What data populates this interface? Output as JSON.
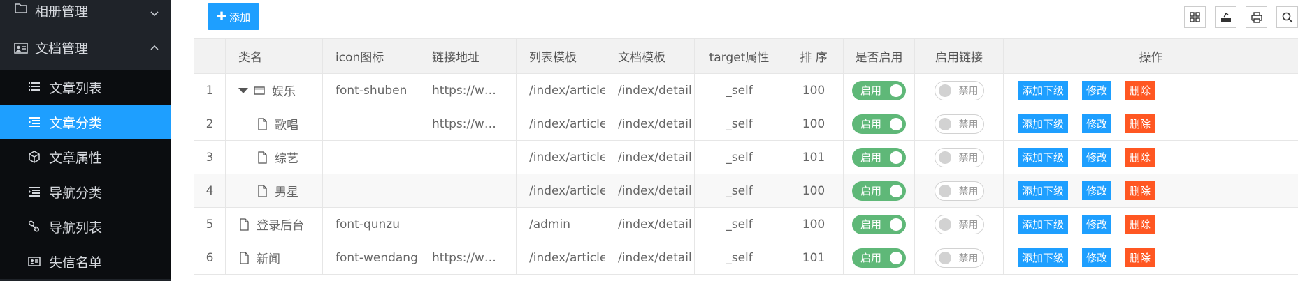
{
  "sidebar": {
    "groups": [
      {
        "label": "相册管理",
        "icon": "folder-icon",
        "expanded": false
      },
      {
        "label": "文档管理",
        "icon": "id-card-icon",
        "expanded": true
      }
    ],
    "items": [
      {
        "label": "文章列表",
        "icon": "list-icon",
        "active": false
      },
      {
        "label": "文章分类",
        "icon": "indent-list-icon",
        "active": true
      },
      {
        "label": "文章属性",
        "icon": "cube-icon",
        "active": false
      },
      {
        "label": "导航分类",
        "icon": "indent-list-icon",
        "active": false
      },
      {
        "label": "导航列表",
        "icon": "link-icon",
        "active": false
      },
      {
        "label": "失信名单",
        "icon": "id-card-icon",
        "active": false
      }
    ]
  },
  "toolbar": {
    "add_label": "添加",
    "icons": [
      "columns-icon",
      "export-icon",
      "print-icon",
      "search-icon"
    ]
  },
  "table": {
    "headers": [
      "",
      "类名",
      "icon图标",
      "链接地址",
      "列表模板",
      "文档模板",
      "target属性",
      "排 序",
      "是否启用",
      "启用链接",
      "操作"
    ],
    "rows": [
      {
        "idx": "1",
        "name": "娱乐",
        "type": "folder",
        "depth": 0,
        "icon": "font-shuben",
        "link": "https://www.baidu.com",
        "list_tpl": "/index/article",
        "doc_tpl": "/index/detail",
        "target": "_self",
        "sort": "100",
        "enabled": "启用",
        "link_enabled": "禁用"
      },
      {
        "idx": "2",
        "name": "歌唱",
        "type": "file",
        "depth": 1,
        "icon": "",
        "link": "https://www.baidu.com",
        "list_tpl": "/index/article",
        "doc_tpl": "/index/detail",
        "target": "_self",
        "sort": "100",
        "enabled": "启用",
        "link_enabled": "禁用"
      },
      {
        "idx": "3",
        "name": "综艺",
        "type": "file",
        "depth": 1,
        "icon": "",
        "link": "",
        "list_tpl": "/index/article",
        "doc_tpl": "/index/detail",
        "target": "_self",
        "sort": "101",
        "enabled": "启用",
        "link_enabled": "禁用"
      },
      {
        "idx": "4",
        "name": "男星",
        "type": "file",
        "depth": 1,
        "icon": "",
        "link": "",
        "list_tpl": "/index/article",
        "doc_tpl": "/index/detail",
        "target": "_self",
        "sort": "100",
        "enabled": "启用",
        "link_enabled": "禁用"
      },
      {
        "idx": "5",
        "name": "登录后台",
        "type": "file",
        "depth": 0,
        "icon": "font-qunzu",
        "link": "",
        "list_tpl": "/admin",
        "doc_tpl": "/index/detail",
        "target": "_self",
        "sort": "100",
        "enabled": "启用",
        "link_enabled": "禁用"
      },
      {
        "idx": "6",
        "name": "新闻",
        "type": "file",
        "depth": 0,
        "icon": "font-wendang",
        "link": "https://www.baidu.com",
        "list_tpl": "/index/article",
        "doc_tpl": "/index/detail",
        "target": "_self",
        "sort": "101",
        "enabled": "启用",
        "link_enabled": "禁用"
      }
    ],
    "actions": {
      "add_child": "添加下级",
      "edit": "修改",
      "delete": "删除"
    }
  },
  "colors": {
    "primary": "#1e9fff",
    "success": "#5fb878",
    "danger": "#ff5722",
    "sidebar_bg": "#1f2329"
  }
}
